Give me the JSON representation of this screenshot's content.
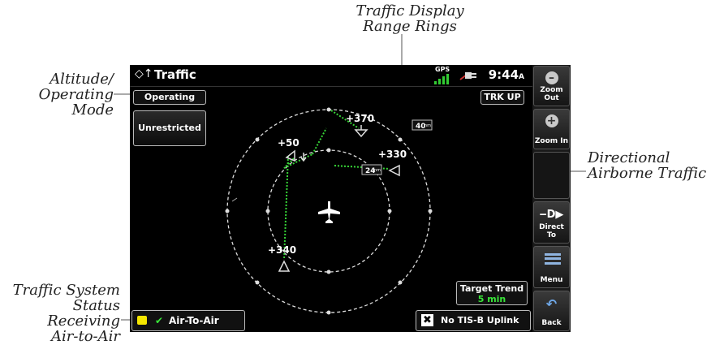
{
  "callouts": {
    "range_rings": [
      "Traffic Display",
      "Range Rings"
    ],
    "altitude_mode": [
      "Altitude/",
      "Operating",
      "Mode"
    ],
    "directional": [
      "Directional",
      "Airborne Traffic"
    ],
    "system_status": [
      "Traffic System",
      "Status Receiving",
      "Air-to-Air"
    ]
  },
  "titlebar": {
    "title": "Traffic",
    "gps": "GPS",
    "time": "9:44",
    "time_suffix": "A"
  },
  "controls": {
    "operating": "Operating",
    "unrestricted": "Unrestricted",
    "trk_up": "TRK UP",
    "range_outer": "40",
    "range_inner": "24",
    "range_unit": "nm"
  },
  "traffic": {
    "t1": "+370",
    "t2": "+50",
    "t3": "+330",
    "t4": "+340"
  },
  "trend": {
    "label": "Target Trend",
    "value": "5 min"
  },
  "status": {
    "air_to_air": "Air-To-Air",
    "tisb": "No TIS-B Uplink"
  },
  "softkeys": {
    "zoom_out": "Zoom Out",
    "zoom_in": "Zoom In",
    "direct_to": "Direct To",
    "menu": "Menu",
    "back": "Back"
  },
  "colors": {
    "accent_green": "#39e639",
    "leader_line": "#37d637"
  }
}
